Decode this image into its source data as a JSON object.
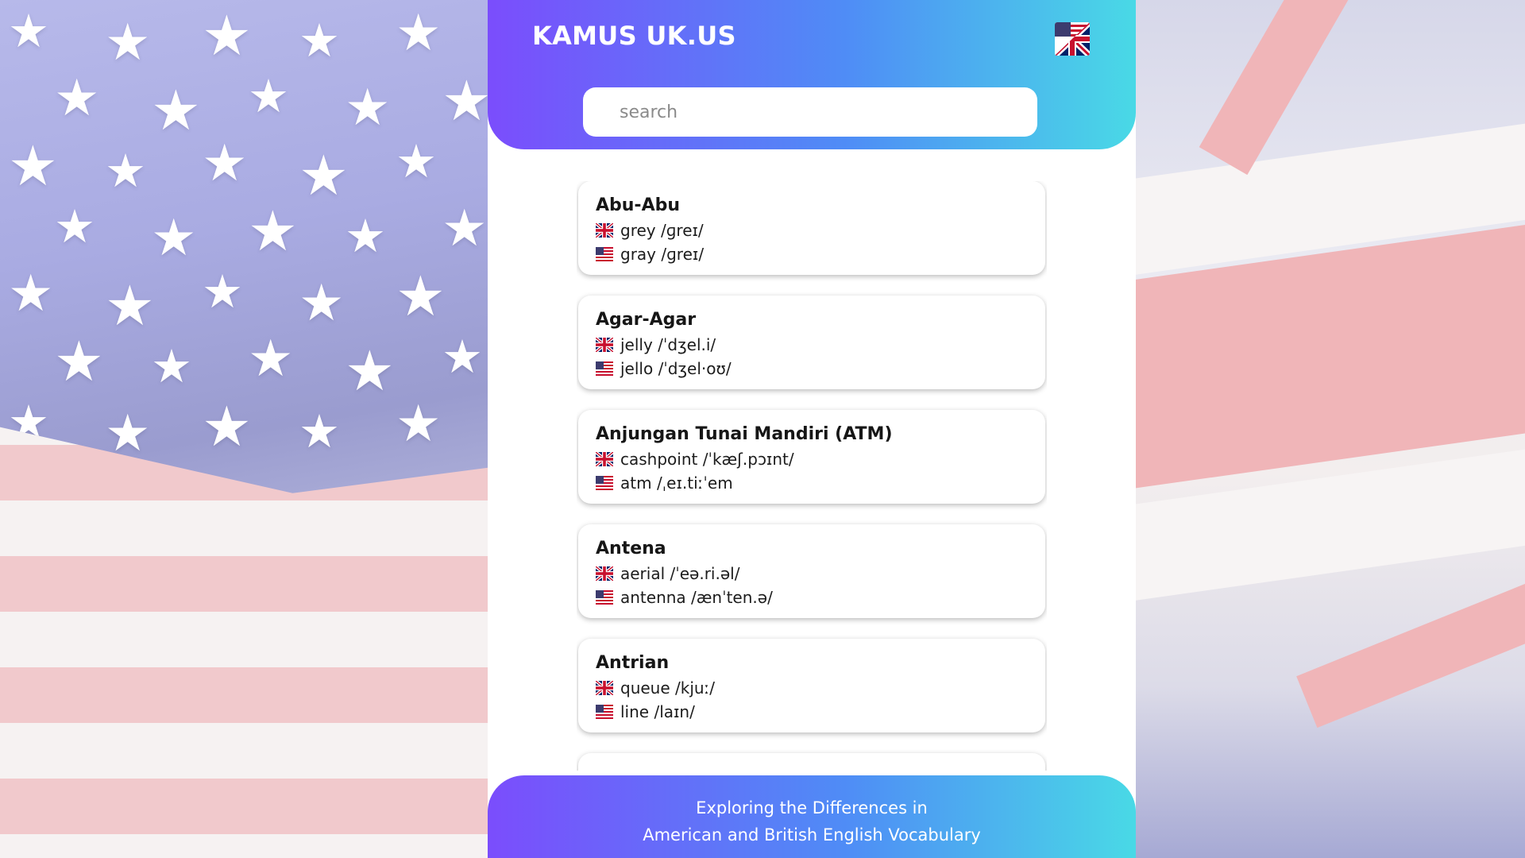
{
  "app": {
    "title": "KAMUS UK.US",
    "flag_icon": "uk-us-flag-icon"
  },
  "search": {
    "placeholder": "search",
    "value": ""
  },
  "entries": [
    {
      "word": "Abu-Abu",
      "uk": "grey /ɡreɪ/",
      "us": "gray /ɡreɪ/"
    },
    {
      "word": "Agar-Agar",
      "uk": "jelly /ˈdʒel.i/",
      "us": "jello /ˈdʒel·oʊ/"
    },
    {
      "word": "Anjungan Tunai Mandiri (ATM)",
      "uk": "cashpoint /ˈkæʃ.pɔɪnt/",
      "us": "atm /ˌeɪ.tiːˈem"
    },
    {
      "word": "Antena",
      "uk": "aerial /ˈeə.ri.əl/",
      "us": "antenna /ænˈten.ə/"
    },
    {
      "word": "Antrian",
      "uk": "queue /kjuː/",
      "us": "line /laɪn/"
    }
  ],
  "footer": {
    "line1": "Exploring the Differences in",
    "line2": "American and British English Vocabulary"
  },
  "colors": {
    "gradient_start": "#7b4dfc",
    "gradient_mid": "#4f8cf6",
    "gradient_end": "#49d9e6",
    "card_bg": "#ffffff"
  },
  "icons": {
    "uk": "uk-flag-icon",
    "us": "us-flag-icon"
  }
}
